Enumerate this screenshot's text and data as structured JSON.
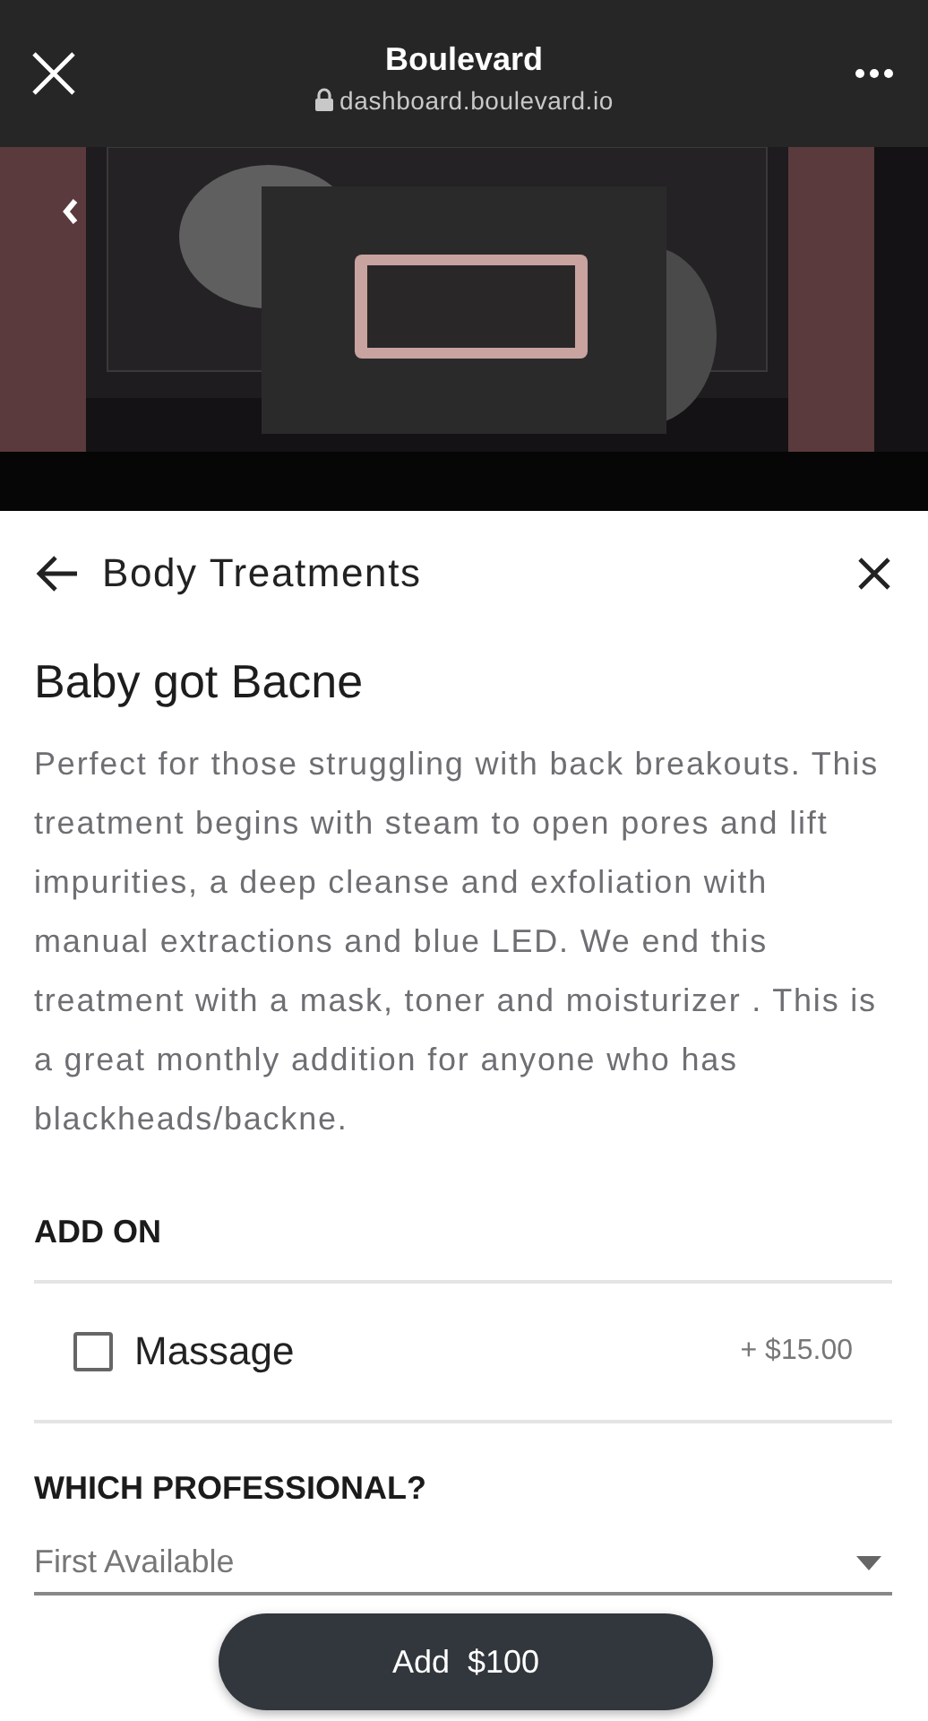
{
  "browser_bar": {
    "title": "Boulevard",
    "url": "dashboard.boulevard.io"
  },
  "nav": {
    "title": "Body Treatments"
  },
  "service": {
    "name": "Baby got Bacne",
    "description": "Perfect for those struggling with back breakouts. This treatment begins with steam to open pores and lift impurities, a deep cleanse and exfoliation with manual extractions and blue LED. We end this treatment with a mask, toner and moisturizer . This is a great monthly addition for anyone who has blackheads/backne."
  },
  "add_on": {
    "heading": "ADD ON",
    "options": [
      {
        "label": "Massage",
        "price": "+ $15.00",
        "checked": false
      }
    ]
  },
  "professional": {
    "heading": "WHICH PROFESSIONAL?",
    "value": "First Available"
  },
  "add_button": {
    "label": "Add  $100"
  }
}
